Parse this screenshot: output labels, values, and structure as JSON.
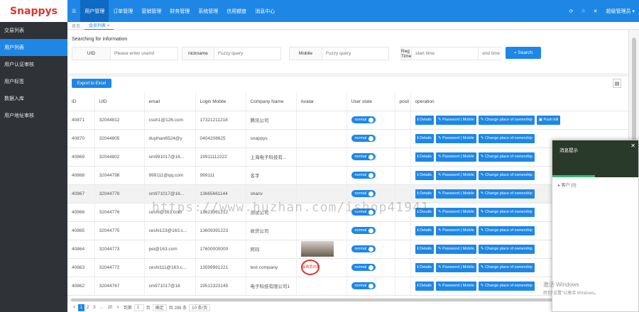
{
  "logo": {
    "text": "Snappys"
  },
  "topnav": {
    "items": [
      {
        "label": "☰"
      },
      {
        "label": "用户管理"
      },
      {
        "label": "订单管理"
      },
      {
        "label": "营销管理"
      },
      {
        "label": "财务管理"
      },
      {
        "label": "系统管理"
      },
      {
        "label": "信用額度"
      },
      {
        "label": "消息中心"
      }
    ],
    "user": "超级管理员 ▾"
  },
  "sidebar": {
    "items": [
      {
        "label": "交易列表"
      },
      {
        "label": "用户列表"
      },
      {
        "label": "用户认证审核"
      },
      {
        "label": "用户标签"
      },
      {
        "label": "数据入库"
      },
      {
        "label": "用户地址审核"
      }
    ]
  },
  "tabs": [
    {
      "label": "首页"
    },
    {
      "label": "会员列表 ×"
    }
  ],
  "search": {
    "title": "Searching for information",
    "uid_label": "UID",
    "uid_placeholder": "Please enter userid",
    "nick_label": "nickname",
    "nick_placeholder": "Fuzzy query",
    "mobile_label": "Mobile",
    "mobile_placeholder": "Fuzzy query",
    "reg_label": "Reg Time",
    "start_placeholder": "start time",
    "end_placeholder": "end time",
    "button": "Search"
  },
  "toolbar": {
    "export": "Export to Excel"
  },
  "table": {
    "headers": [
      "ID",
      "UID",
      "email",
      "Login Mobile",
      "Company Name",
      "Avatar",
      "User state",
      "posit",
      "operation"
    ],
    "rows": [
      {
        "id": "40871",
        "uid": "32044812",
        "email": "cssh1@126.com",
        "mobile": "17321211218",
        "company": "腾讯公司",
        "avatar": "",
        "state": "normal"
      },
      {
        "id": "40870",
        "uid": "32044805",
        "email": "duyihan6524@y",
        "mobile": "0404208625",
        "company": "snappys",
        "avatar": "",
        "state": "normal"
      },
      {
        "id": "40869",
        "uid": "32044802",
        "email": "sm991017@16...",
        "mobile": "19911112222",
        "company": "上海电子科技有...",
        "avatar": "",
        "state": "normal"
      },
      {
        "id": "40868",
        "uid": "32044798",
        "email": "999111@qq.com",
        "mobile": "999111",
        "company": "名字",
        "avatar": "",
        "state": "normal"
      },
      {
        "id": "40867",
        "uid": "32044778",
        "email": "sm971017@16...",
        "mobile": "13665661144",
        "company": "shanv",
        "avatar": "",
        "state": "normal"
      },
      {
        "id": "40866",
        "uid": "32044776",
        "email": "ceshi@163.com",
        "mobile": "13623361212",
        "company": "测试公司",
        "avatar": "",
        "state": "normal"
      },
      {
        "id": "40865",
        "uid": "32044775",
        "email": "ceshi123@163.c...",
        "mobile": "13609391223",
        "company": "收货公司",
        "avatar": "",
        "state": "normal"
      },
      {
        "id": "40864",
        "uid": "32044773",
        "email": "pei@163.com",
        "mobile": "17600000000",
        "company": "阿玛",
        "avatar": "photo",
        "state": "normal"
      },
      {
        "id": "40863",
        "uid": "32044772",
        "email": "ceshi111@163.c...",
        "mobile": "13599991221",
        "company": "test company",
        "avatar": "stamp",
        "state": "normal"
      },
      {
        "id": "40862",
        "uid": "32044767",
        "email": "sm971017@16",
        "mobile": "19512323145",
        "company": "电子科技有限公司1",
        "avatar": "",
        "state": "normal"
      }
    ],
    "ops": {
      "details": "Details",
      "password": "Password | Mobile",
      "change": "Change place of ownership",
      "push": "Push bill"
    }
  },
  "stamp": {
    "text": "采购员印章"
  },
  "pager": {
    "prev": "<",
    "pages": [
      "1",
      "2",
      "3",
      "...",
      "20"
    ],
    "next": ">",
    "goto": "到第",
    "page_unit": "页",
    "confirm": "确定",
    "total": "共 288 条",
    "size": "10 条/页"
  },
  "chat": {
    "title": "消息提示",
    "list_label": "▸ 客户 (0)"
  },
  "watermark": "https://www.huzhan.com/ishop41941",
  "activation": {
    "line1": "激活 Windows",
    "line2": "转到“设置”以激活 Windows。"
  }
}
